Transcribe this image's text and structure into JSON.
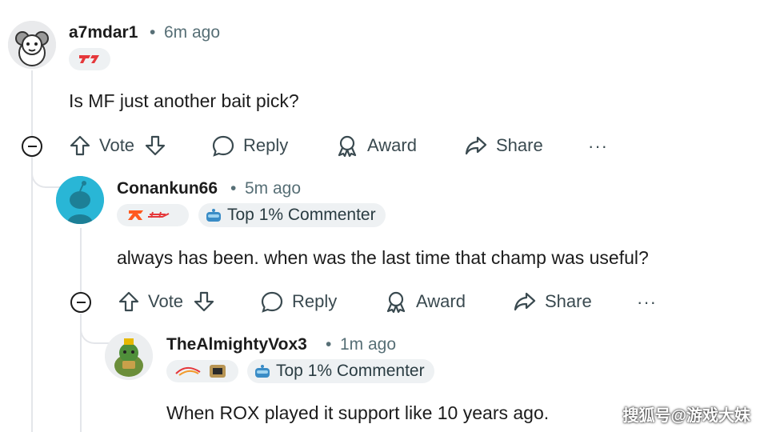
{
  "comments": [
    {
      "username": "a7mdar1",
      "time": "6m ago",
      "flair_icon": "t1-team-logo",
      "text": "Is MF just another bait pick?",
      "actions": {
        "vote": "Vote",
        "reply": "Reply",
        "award": "Award",
        "share": "Share",
        "more": "···"
      }
    },
    {
      "username": "Conankun66",
      "time": "5m ago",
      "flair_icon": "fnatic-team-logo",
      "badge": "Top 1% Commenter",
      "text": "always has been. when was the last time that champ was useful?",
      "actions": {
        "vote": "Vote",
        "reply": "Reply",
        "award": "Award",
        "share": "Share",
        "more": "···"
      }
    },
    {
      "username": "TheAlmightyVox3",
      "time": "1m ago",
      "flair_icon": "gen-g-team-logo",
      "badge": "Top 1% Commenter",
      "text": "When ROX played it support like 10 years ago."
    }
  ],
  "separator": "•",
  "watermark": "搜狐号@游戏大妹",
  "colors": {
    "accent_red": "#e5383b",
    "avatar_teal": "#29b6d6",
    "muted": "#576f76"
  }
}
